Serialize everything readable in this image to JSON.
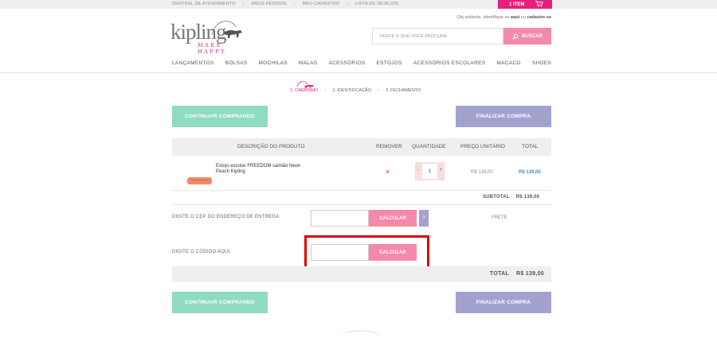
{
  "topbar": {
    "links": [
      "CENTRAL DE ATENDIMENTO",
      "MEUS PEDIDOS",
      "MEU CADASTRO",
      "LISTA DE DESEJOS"
    ],
    "cart_label": "1 ITEM",
    "cart_icon": "cart-icon"
  },
  "header": {
    "logo_text": "kipling",
    "logo_tagline": "MAKE HAPPY",
    "welcome_prefix": "Olá visitante, identifique-se",
    "welcome_link1": "aqui",
    "welcome_mid": "ou",
    "welcome_link2": "cadastre-se",
    "search_placeholder": "DIGITE O QUE VOCÊ PROCURA",
    "search_button": "BUSCAR",
    "search_icon": "search-icon"
  },
  "nav": [
    "LANÇAMENTOS",
    "BOLSAS",
    "MOCHILAS",
    "MALAS",
    "ACESSÓRIOS",
    "ESTOJOS",
    "ACESSÓRIOS ESCOLARES",
    "MACACO",
    "SHOES"
  ],
  "steps": [
    "1. CARRINHO",
    "2. IDENTIFICAÇÃO",
    "3. FECHAMENTO"
  ],
  "actions": {
    "continue": "CONTINUAR COMPRANDO",
    "finalize": "FINALIZAR COMPRA"
  },
  "table": {
    "headers": [
      "DESCRIÇÃO DO PRODUTO",
      "REMOVER",
      "QUANTIDADE",
      "PREÇO UNITÁRIO",
      "TOTAL"
    ],
    "item": {
      "name": "Estojo escolar FREEDOM salmão Neon Peach Kipling",
      "remove": "×",
      "qty_minus": "-",
      "qty": "1",
      "qty_plus": "+",
      "unit_price": "R$ 139,00",
      "total": "R$ 139,00"
    },
    "subtotal_label": "SUBTOTAL",
    "subtotal_value": "R$ 139,00"
  },
  "shipping": {
    "label": "DIGITE O CEP DO ENDEREÇO DE ENTREGA:",
    "button": "CALCULAR",
    "help": "?",
    "frete_label": "FRETE"
  },
  "coupon": {
    "label": "DIGITE O CÓDIGO AQUI:",
    "button": "CALCULAR"
  },
  "summary": {
    "total_label": "TOTAL",
    "total_value": "R$ 139,00"
  },
  "colors": {
    "brand_pink": "#e5207c",
    "button_pink": "#f48aaa",
    "continue_green": "#8fdbbf",
    "finalize_purple": "#a3a2cf",
    "highlight_red": "#e00000"
  }
}
